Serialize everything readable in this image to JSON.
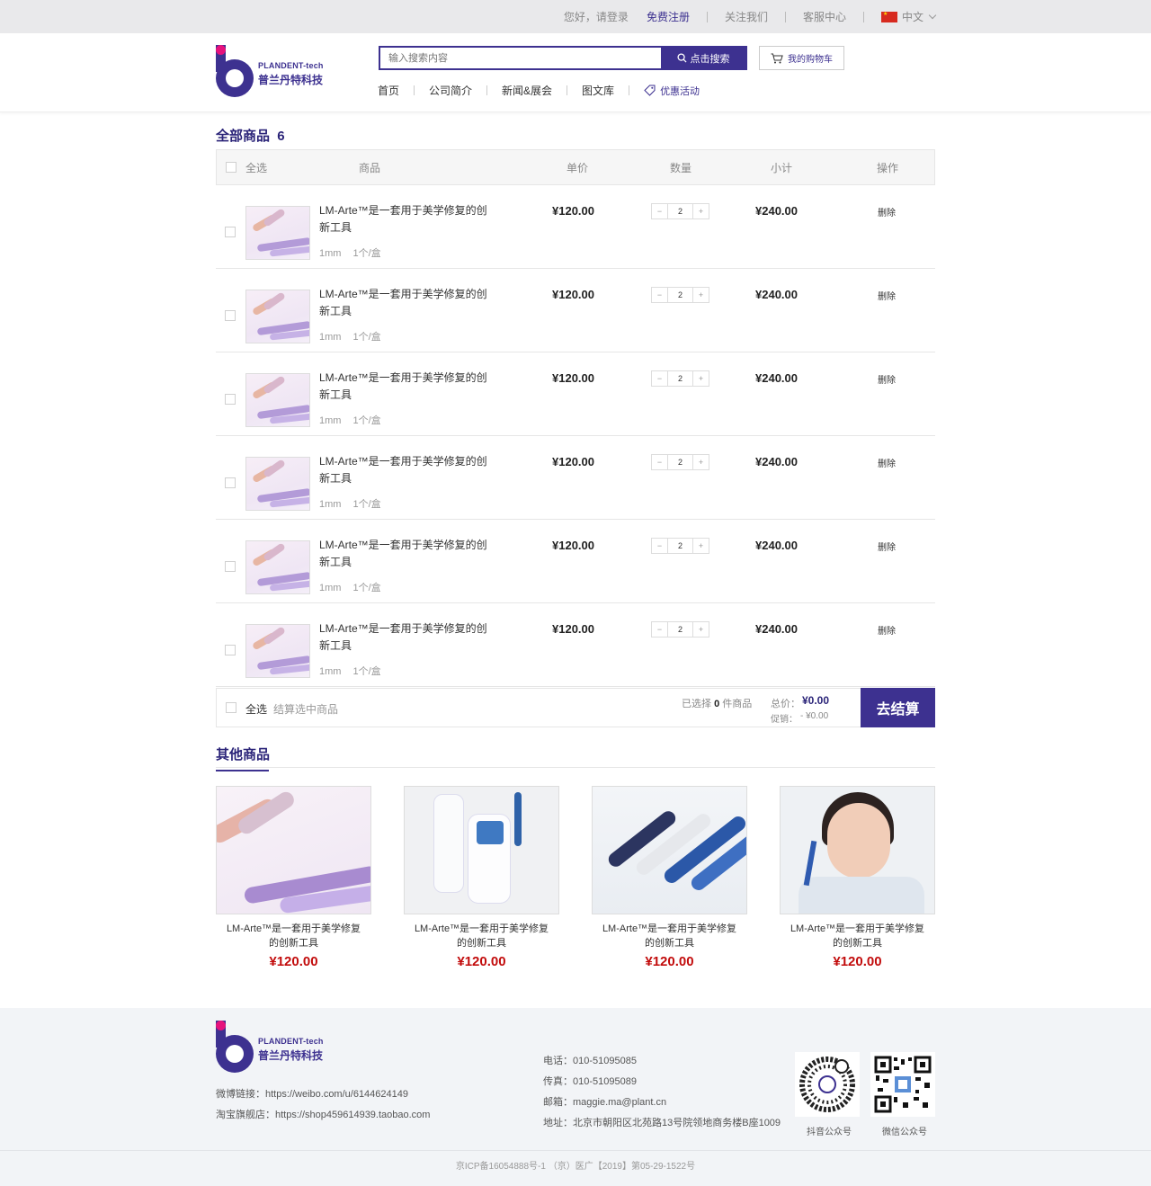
{
  "topbar": {
    "greeting": "您好，请登录",
    "register": "免费注册",
    "follow": "关注我们",
    "service": "客服中心",
    "language": "中文"
  },
  "brand": {
    "name_en": "PLANDENT-tech",
    "name_cn": "普兰丹特科技"
  },
  "search": {
    "placeholder": "输入搜索内容",
    "button": "点击搜索"
  },
  "cart_button": "我的购物车",
  "nav": [
    "首页",
    "公司简介",
    "新闻&展会",
    "图文库"
  ],
  "nav_promo": "优惠活动",
  "cart": {
    "title": "全部商品",
    "count": "6",
    "headers": {
      "select_all": "全选",
      "product": "商品",
      "unit_price": "单价",
      "quantity": "数量",
      "subtotal": "小计",
      "action": "操作"
    },
    "items": [
      {
        "name": "LM-Arte™是一套用于美学修复的创新工具",
        "spec": "1mm",
        "pack": "1个/盒",
        "price": "¥120.00",
        "qty": "2",
        "subtotal": "¥240.00",
        "action": "删除"
      },
      {
        "name": "LM-Arte™是一套用于美学修复的创新工具",
        "spec": "1mm",
        "pack": "1个/盒",
        "price": "¥120.00",
        "qty": "2",
        "subtotal": "¥240.00",
        "action": "删除"
      },
      {
        "name": "LM-Arte™是一套用于美学修复的创新工具",
        "spec": "1mm",
        "pack": "1个/盒",
        "price": "¥120.00",
        "qty": "2",
        "subtotal": "¥240.00",
        "action": "删除"
      },
      {
        "name": "LM-Arte™是一套用于美学修复的创新工具",
        "spec": "1mm",
        "pack": "1个/盒",
        "price": "¥120.00",
        "qty": "2",
        "subtotal": "¥240.00",
        "action": "删除"
      },
      {
        "name": "LM-Arte™是一套用于美学修复的创新工具",
        "spec": "1mm",
        "pack": "1个/盒",
        "price": "¥120.00",
        "qty": "2",
        "subtotal": "¥240.00",
        "action": "删除"
      },
      {
        "name": "LM-Arte™是一套用于美学修复的创新工具",
        "spec": "1mm",
        "pack": "1个/盒",
        "price": "¥120.00",
        "qty": "2",
        "subtotal": "¥240.00",
        "action": "删除"
      }
    ],
    "footer": {
      "select_all": "全选",
      "checkout_selected": "结算选中商品",
      "selected_prefix": "已选择",
      "selected_count": "0",
      "selected_suffix": "件商品",
      "total_label": "总价：",
      "total_value": "¥0.00",
      "promo_label": "促销：",
      "promo_value": "- ¥0.00",
      "checkout": "去结算"
    }
  },
  "others": {
    "title": "其他商品",
    "items": [
      {
        "name": "LM-Arte™是一套用于美学修复的创新工具",
        "price": "¥120.00"
      },
      {
        "name": "LM-Arte™是一套用于美学修复的创新工具",
        "price": "¥120.00"
      },
      {
        "name": "LM-Arte™是一套用于美学修复的创新工具",
        "price": "¥120.00"
      },
      {
        "name": "LM-Arte™是一套用于美学修复的创新工具",
        "price": "¥120.00"
      }
    ]
  },
  "footer": {
    "weibo": "微博链接：https://weibo.com/u/6144624149",
    "taobao": "淘宝旗舰店：https://shop459614939.taobao.com",
    "phone": "电话：010-51095085",
    "fax": "传真：010-51095089",
    "email": "邮箱：maggie.ma@plant.cn",
    "address": "地址：北京市朝阳区北苑路13号院领地商务楼B座1009",
    "qr_douyin": "抖音公众号",
    "qr_wechat": "微信公众号",
    "copyright": "京ICP备16054888号-1 （京）医广【2019】第05-29-1522号"
  },
  "colors": {
    "brand": "#3d3190",
    "accent": "#e6127d",
    "price_red": "#c20c0c"
  }
}
